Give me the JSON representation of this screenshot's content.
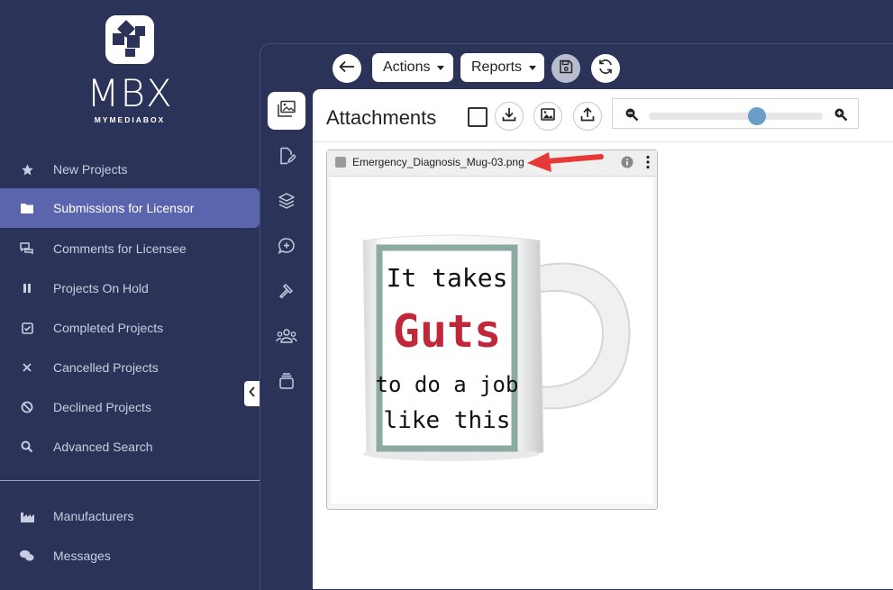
{
  "brand": {
    "name": "MBX",
    "tagline": "MYMEDIABOX"
  },
  "sidebar": {
    "items": [
      {
        "label": "New Projects",
        "icon": "star-icon"
      },
      {
        "label": "Submissions for Licensor",
        "icon": "folder-icon",
        "active": true
      },
      {
        "label": "Comments for Licensee",
        "icon": "comments-icon"
      },
      {
        "label": "Projects On Hold",
        "icon": "pause-icon"
      },
      {
        "label": "Completed Projects",
        "icon": "checkbox-icon"
      },
      {
        "label": "Cancelled Projects",
        "icon": "x-icon"
      },
      {
        "label": "Declined Projects",
        "icon": "ban-icon"
      },
      {
        "label": "Advanced Search",
        "icon": "search-icon"
      }
    ],
    "bottom_items": [
      {
        "label": "Manufacturers",
        "icon": "factory-icon"
      },
      {
        "label": "Messages",
        "icon": "messages-icon"
      }
    ]
  },
  "toolbar": {
    "actions_label": "Actions",
    "reports_label": "Reports"
  },
  "attachments": {
    "title": "Attachments",
    "zoom_level": 0.62,
    "file": {
      "name": "Emergency_Diagnosis_Mug-03.png"
    }
  },
  "mug": {
    "line1": "It takes",
    "line2": "Guts",
    "line3": "to do a job",
    "line4": "like this"
  },
  "colors": {
    "sidebar_bg": "#2c3358",
    "active_item": "#5b65ae",
    "mug_frame": "#8aaaa3",
    "mug_accent": "#c0283a",
    "annotation_arrow": "#e53935",
    "zoom_thumb": "#6b9dc9"
  }
}
